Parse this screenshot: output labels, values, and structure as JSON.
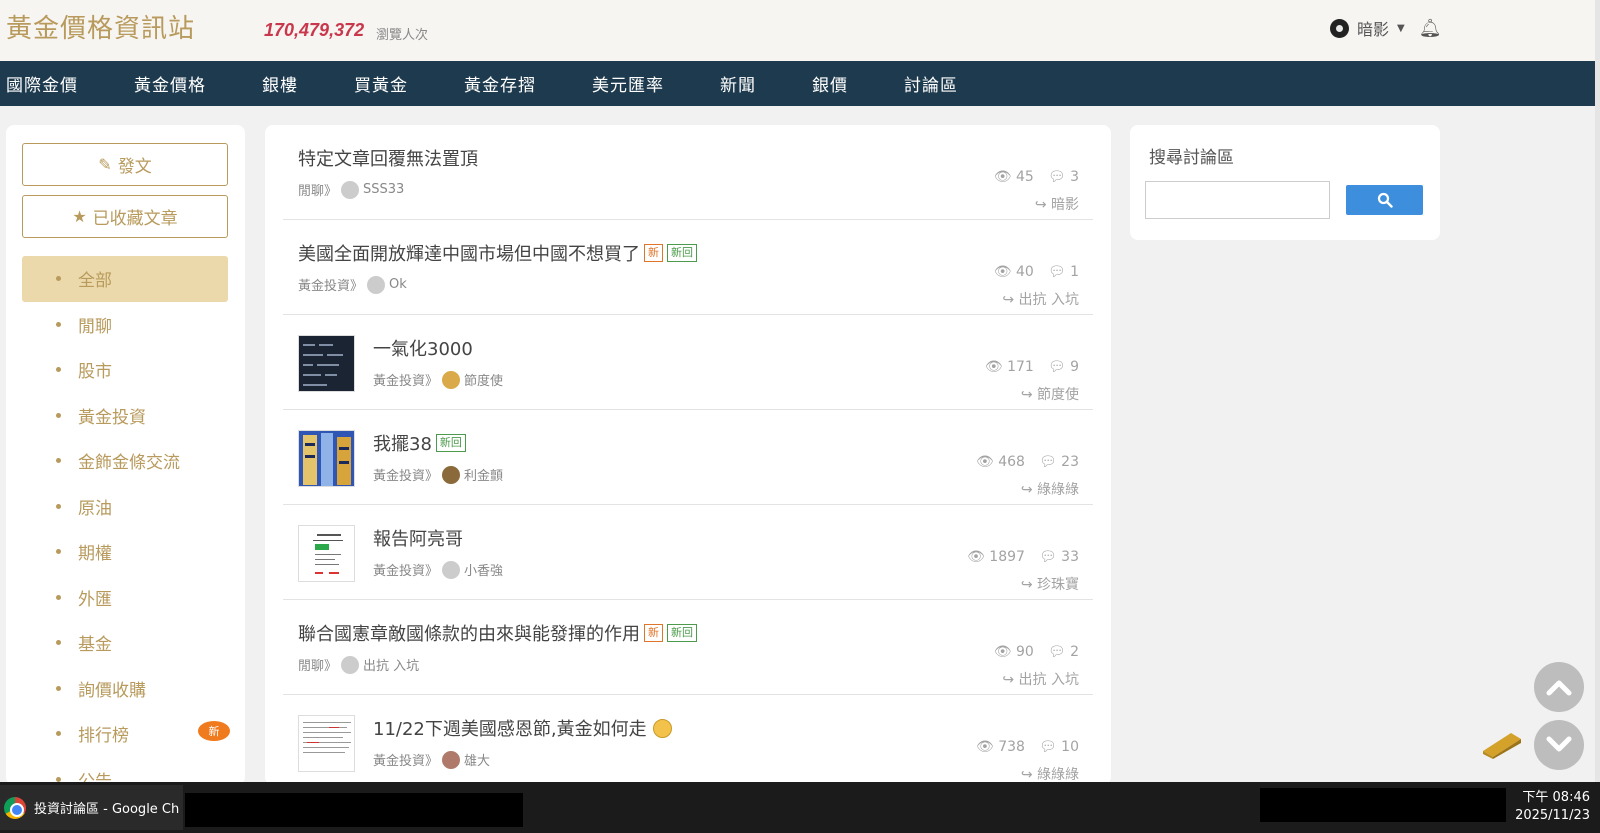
{
  "header": {
    "site_title": "黃金價格資訊站",
    "visits": "170,479,372",
    "visits_label": "瀏覽人次",
    "user_name": "暗影"
  },
  "nav": {
    "items": [
      {
        "label": "國際金價"
      },
      {
        "label": "黃金價格"
      },
      {
        "label": "銀樓"
      },
      {
        "label": "買黃金"
      },
      {
        "label": "黃金存摺"
      },
      {
        "label": "美元匯率"
      },
      {
        "label": "新聞"
      },
      {
        "label": "銀價"
      },
      {
        "label": "討論區"
      }
    ]
  },
  "sidebar": {
    "post_button": "發文",
    "saved_button": "已收藏文章",
    "categories": [
      {
        "label": "全部"
      },
      {
        "label": "閒聊"
      },
      {
        "label": "股市"
      },
      {
        "label": "黃金投資"
      },
      {
        "label": "金飾金條交流"
      },
      {
        "label": "原油"
      },
      {
        "label": "期權"
      },
      {
        "label": "外匯"
      },
      {
        "label": "基金"
      },
      {
        "label": "詢價收購"
      },
      {
        "label": "排行榜"
      },
      {
        "label": "公告"
      }
    ],
    "ranking_badge": "新"
  },
  "posts": [
    {
      "title": "特定文章回覆無法置頂",
      "category": "閒聊》",
      "author": "SSS33",
      "views": "45",
      "replies": "3",
      "last_reply": "暗影"
    },
    {
      "title": "美國全面開放輝達中國市場但中國不想買了",
      "tag_new": "新",
      "tag_reply": "新回",
      "category": "黃金投資》",
      "author": "Ok",
      "views": "40",
      "replies": "1",
      "last_reply": "出抗 入坑"
    },
    {
      "title": "一氣化3000",
      "category": "黃金投資》",
      "author": "節度使",
      "views": "171",
      "replies": "9",
      "last_reply": "節度使"
    },
    {
      "title": "我擺38",
      "tag_reply": "新回",
      "category": "黃金投資》",
      "author": "利金顫",
      "views": "468",
      "replies": "23",
      "last_reply": "綠綠綠"
    },
    {
      "title": "報告阿亮哥",
      "category": "黃金投資》",
      "author": "小香強",
      "views": "1897",
      "replies": "33",
      "last_reply": "珍珠寶"
    },
    {
      "title": "聯合國憲章敵國條款的由來與能發揮的作用",
      "tag_new": "新",
      "tag_reply": "新回",
      "category": "閒聊》",
      "author": "出抗 入坑",
      "views": "90",
      "replies": "2",
      "last_reply": "出抗 入坑"
    },
    {
      "title": "11/22下週美國感恩節,黃金如何走",
      "category": "黃金投資》",
      "author": "雄大",
      "views": "738",
      "replies": "10",
      "last_reply": "綠綠綠"
    }
  ],
  "search": {
    "title": "搜尋討論區",
    "input_value": ""
  },
  "taskbar": {
    "app_label": "投資討論區 - Google Ch",
    "time": "下午 08:46",
    "date": "2025/11/23"
  },
  "colors": {
    "accent": "#b89a5c",
    "nav_bg": "#1e3a4e",
    "visits": "#c9374c",
    "active_category": "#ecd9ab",
    "search_button": "#3d8fdd"
  }
}
